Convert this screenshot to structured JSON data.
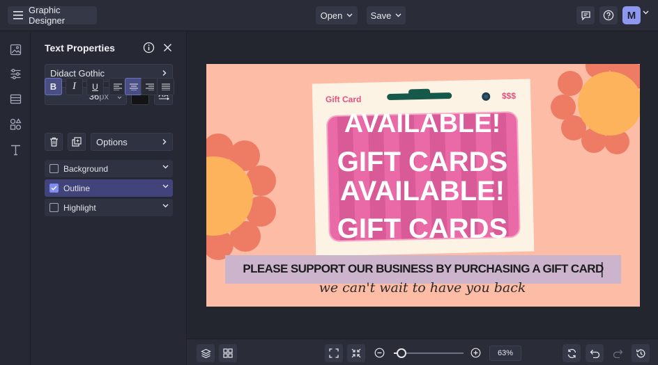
{
  "app": {
    "title": "Graphic Designer"
  },
  "toolbar": {
    "open_label": "Open",
    "save_label": "Save",
    "avatar_letter": "M"
  },
  "panel": {
    "title": "Text Properties",
    "font_name": "Didact Gothic",
    "font_size_value": "36",
    "font_size_unit": "px",
    "text_color": "#141414",
    "options_label": "Options",
    "accordions": [
      {
        "label": "Background",
        "checked": false
      },
      {
        "label": "Outline",
        "checked": true
      },
      {
        "label": "Highlight",
        "checked": false
      }
    ]
  },
  "design": {
    "card_label": "Gift Card",
    "card_price": "$$$",
    "line1": "AVAILABLE!",
    "line2": "GIFT CARDS",
    "line3": "AVAILABLE!",
    "line4": "GIFT CARDS",
    "headline": "PLEASE SUPPORT OUR BUSINESS BY PURCHASING A GIFT CARD",
    "tagline": "we can't wait to have you back"
  },
  "zoom": {
    "label": "63%",
    "value_percent": 63
  },
  "colors": {
    "accent": "#7f8cf0",
    "canvas_bg": "#fdbca6",
    "card_pink": "#e96aa6",
    "flower_petal": "#ee7c64",
    "flower_center": "#fdb35c"
  }
}
